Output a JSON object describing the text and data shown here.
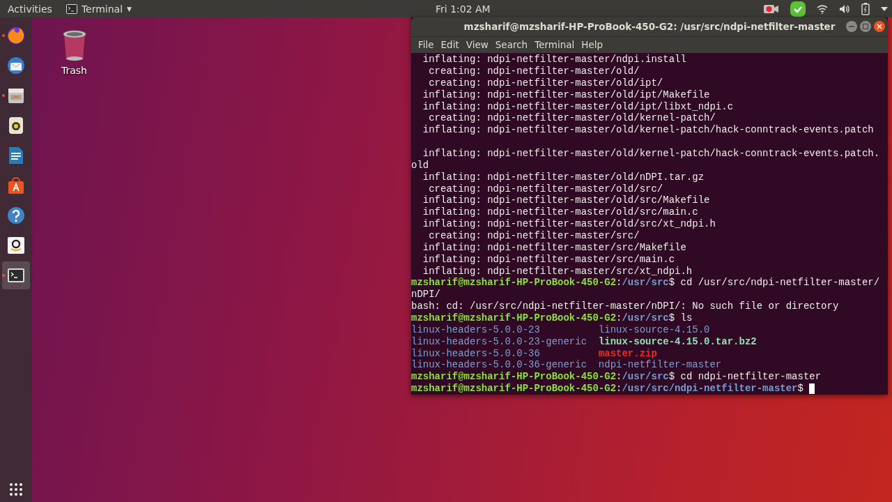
{
  "top_bar": {
    "activities": "Activities",
    "app_menu": {
      "label": "Terminal",
      "caret": "▼"
    },
    "clock": "Fri  1:02 AM"
  },
  "dock": {
    "items": [
      {
        "kind": "firefox",
        "running": true,
        "selected": false
      },
      {
        "kind": "mail",
        "running": false,
        "selected": false
      },
      {
        "kind": "files",
        "running": true,
        "selected": false
      },
      {
        "kind": "music",
        "running": false,
        "selected": false
      },
      {
        "kind": "writer",
        "running": false,
        "selected": false
      },
      {
        "kind": "software",
        "running": false,
        "selected": false
      },
      {
        "kind": "help",
        "running": false,
        "selected": false
      },
      {
        "kind": "amazon",
        "running": false,
        "selected": false
      },
      {
        "kind": "terminal",
        "running": true,
        "selected": true
      }
    ]
  },
  "desktop_icons": [
    {
      "label": "Trash"
    }
  ],
  "terminal": {
    "title": "mzsharif@mzsharif-HP-ProBook-450-G2: /usr/src/ndpi-netfilter-master",
    "menu": [
      "File",
      "Edit",
      "View",
      "Search",
      "Terminal",
      "Help"
    ],
    "rows": [
      {
        "kind": "text",
        "segments": [
          {
            "kind": "plain",
            "text": "  inflating: ndpi-netfilter-master/ndpi.install"
          }
        ]
      },
      {
        "kind": "text",
        "segments": [
          {
            "kind": "plain",
            "text": "   creating: ndpi-netfilter-master/old/"
          }
        ]
      },
      {
        "kind": "text",
        "segments": [
          {
            "kind": "plain",
            "text": "   creating: ndpi-netfilter-master/old/ipt/"
          }
        ]
      },
      {
        "kind": "text",
        "segments": [
          {
            "kind": "plain",
            "text": "  inflating: ndpi-netfilter-master/old/ipt/Makefile"
          }
        ]
      },
      {
        "kind": "text",
        "segments": [
          {
            "kind": "plain",
            "text": "  inflating: ndpi-netfilter-master/old/ipt/libxt_ndpi.c"
          }
        ]
      },
      {
        "kind": "text",
        "segments": [
          {
            "kind": "plain",
            "text": "   creating: ndpi-netfilter-master/old/kernel-patch/"
          }
        ]
      },
      {
        "kind": "text",
        "segments": [
          {
            "kind": "plain",
            "text": "  inflating: ndpi-netfilter-master/old/kernel-patch/hack-conntrack-events.patch"
          }
        ]
      },
      {
        "kind": "blank"
      },
      {
        "kind": "text",
        "segments": [
          {
            "kind": "plain",
            "text": "  inflating: ndpi-netfilter-master/old/kernel-patch/hack-conntrack-events.patch."
          }
        ]
      },
      {
        "kind": "text",
        "segments": [
          {
            "kind": "plain",
            "text": "old"
          }
        ]
      },
      {
        "kind": "text",
        "segments": [
          {
            "kind": "plain",
            "text": "  inflating: ndpi-netfilter-master/old/nDPI.tar.gz"
          }
        ]
      },
      {
        "kind": "text",
        "segments": [
          {
            "kind": "plain",
            "text": "   creating: ndpi-netfilter-master/old/src/"
          }
        ]
      },
      {
        "kind": "text",
        "segments": [
          {
            "kind": "plain",
            "text": "  inflating: ndpi-netfilter-master/old/src/Makefile"
          }
        ]
      },
      {
        "kind": "text",
        "segments": [
          {
            "kind": "plain",
            "text": "  inflating: ndpi-netfilter-master/old/src/main.c"
          }
        ]
      },
      {
        "kind": "text",
        "segments": [
          {
            "kind": "plain",
            "text": "  inflating: ndpi-netfilter-master/old/src/xt_ndpi.h"
          }
        ]
      },
      {
        "kind": "text",
        "segments": [
          {
            "kind": "plain",
            "text": "   creating: ndpi-netfilter-master/src/"
          }
        ]
      },
      {
        "kind": "text",
        "segments": [
          {
            "kind": "plain",
            "text": "  inflating: ndpi-netfilter-master/src/Makefile"
          }
        ]
      },
      {
        "kind": "text",
        "segments": [
          {
            "kind": "plain",
            "text": "  inflating: ndpi-netfilter-master/src/main.c"
          }
        ]
      },
      {
        "kind": "text",
        "segments": [
          {
            "kind": "plain",
            "text": "  inflating: ndpi-netfilter-master/src/xt_ndpi.h"
          }
        ]
      },
      {
        "kind": "text",
        "segments": [
          {
            "kind": "user",
            "text": "mzsharif@mzsharif-HP-ProBook-450-G2"
          },
          {
            "kind": "plain",
            "text": ":"
          },
          {
            "kind": "path",
            "text": "/usr/src"
          },
          {
            "kind": "plain",
            "text": "$ cd /usr/src/ndpi-netfilter-master/"
          }
        ]
      },
      {
        "kind": "text",
        "segments": [
          {
            "kind": "plain",
            "text": "nDPI/"
          }
        ]
      },
      {
        "kind": "text",
        "segments": [
          {
            "kind": "plain",
            "text": "bash: cd: /usr/src/ndpi-netfilter-master/nDPI/: No such file or directory"
          }
        ]
      },
      {
        "kind": "text",
        "segments": [
          {
            "kind": "user",
            "text": "mzsharif@mzsharif-HP-ProBook-450-G2"
          },
          {
            "kind": "plain",
            "text": ":"
          },
          {
            "kind": "path",
            "text": "/usr/src"
          },
          {
            "kind": "plain",
            "text": "$ ls"
          }
        ]
      },
      {
        "kind": "columns",
        "cells": [
          {
            "kind": "dir",
            "text": "linux-headers-5.0.0-23"
          },
          {
            "kind": "dir",
            "text": "linux-source-4.15.0"
          }
        ]
      },
      {
        "kind": "columns",
        "cells": [
          {
            "kind": "dir",
            "text": "linux-headers-5.0.0-23-generic"
          },
          {
            "kind": "link",
            "text": "linux-source-4.15.0.tar.bz2"
          }
        ]
      },
      {
        "kind": "columns",
        "cells": [
          {
            "kind": "dir",
            "text": "linux-headers-5.0.0-36"
          },
          {
            "kind": "archive",
            "text": "master.zip"
          }
        ]
      },
      {
        "kind": "columns",
        "cells": [
          {
            "kind": "dir",
            "text": "linux-headers-5.0.0-36-generic"
          },
          {
            "kind": "dir",
            "text": "ndpi-netfilter-master"
          }
        ]
      },
      {
        "kind": "text",
        "segments": [
          {
            "kind": "user",
            "text": "mzsharif@mzsharif-HP-ProBook-450-G2"
          },
          {
            "kind": "plain",
            "text": ":"
          },
          {
            "kind": "path",
            "text": "/usr/src"
          },
          {
            "kind": "plain",
            "text": "$ cd ndpi-netfilter-master"
          }
        ]
      },
      {
        "kind": "text",
        "cursor": true,
        "segments": [
          {
            "kind": "user",
            "text": "mzsharif@mzsharif-HP-ProBook-450-G2"
          },
          {
            "kind": "plain",
            "text": ":"
          },
          {
            "kind": "path",
            "text": "/usr/src/ndpi-netfilter-master"
          },
          {
            "kind": "plain",
            "text": "$ "
          }
        ]
      }
    ]
  }
}
